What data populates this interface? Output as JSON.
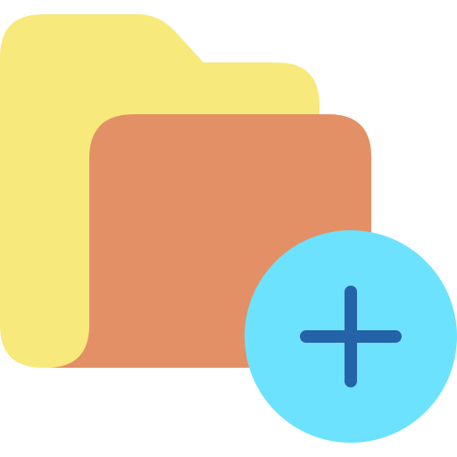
{
  "icon": {
    "name": "add-folder-icon",
    "parts": [
      "folder-back-icon",
      "folder-front-icon",
      "add-badge-icon",
      "plus-icon"
    ]
  },
  "colors": {
    "folder_back": "#F7E97C",
    "folder_front": "#E39066",
    "badge_circle": "#6CE2FF",
    "plus_sign": "#2563A8",
    "background": "#FFFFFF"
  }
}
